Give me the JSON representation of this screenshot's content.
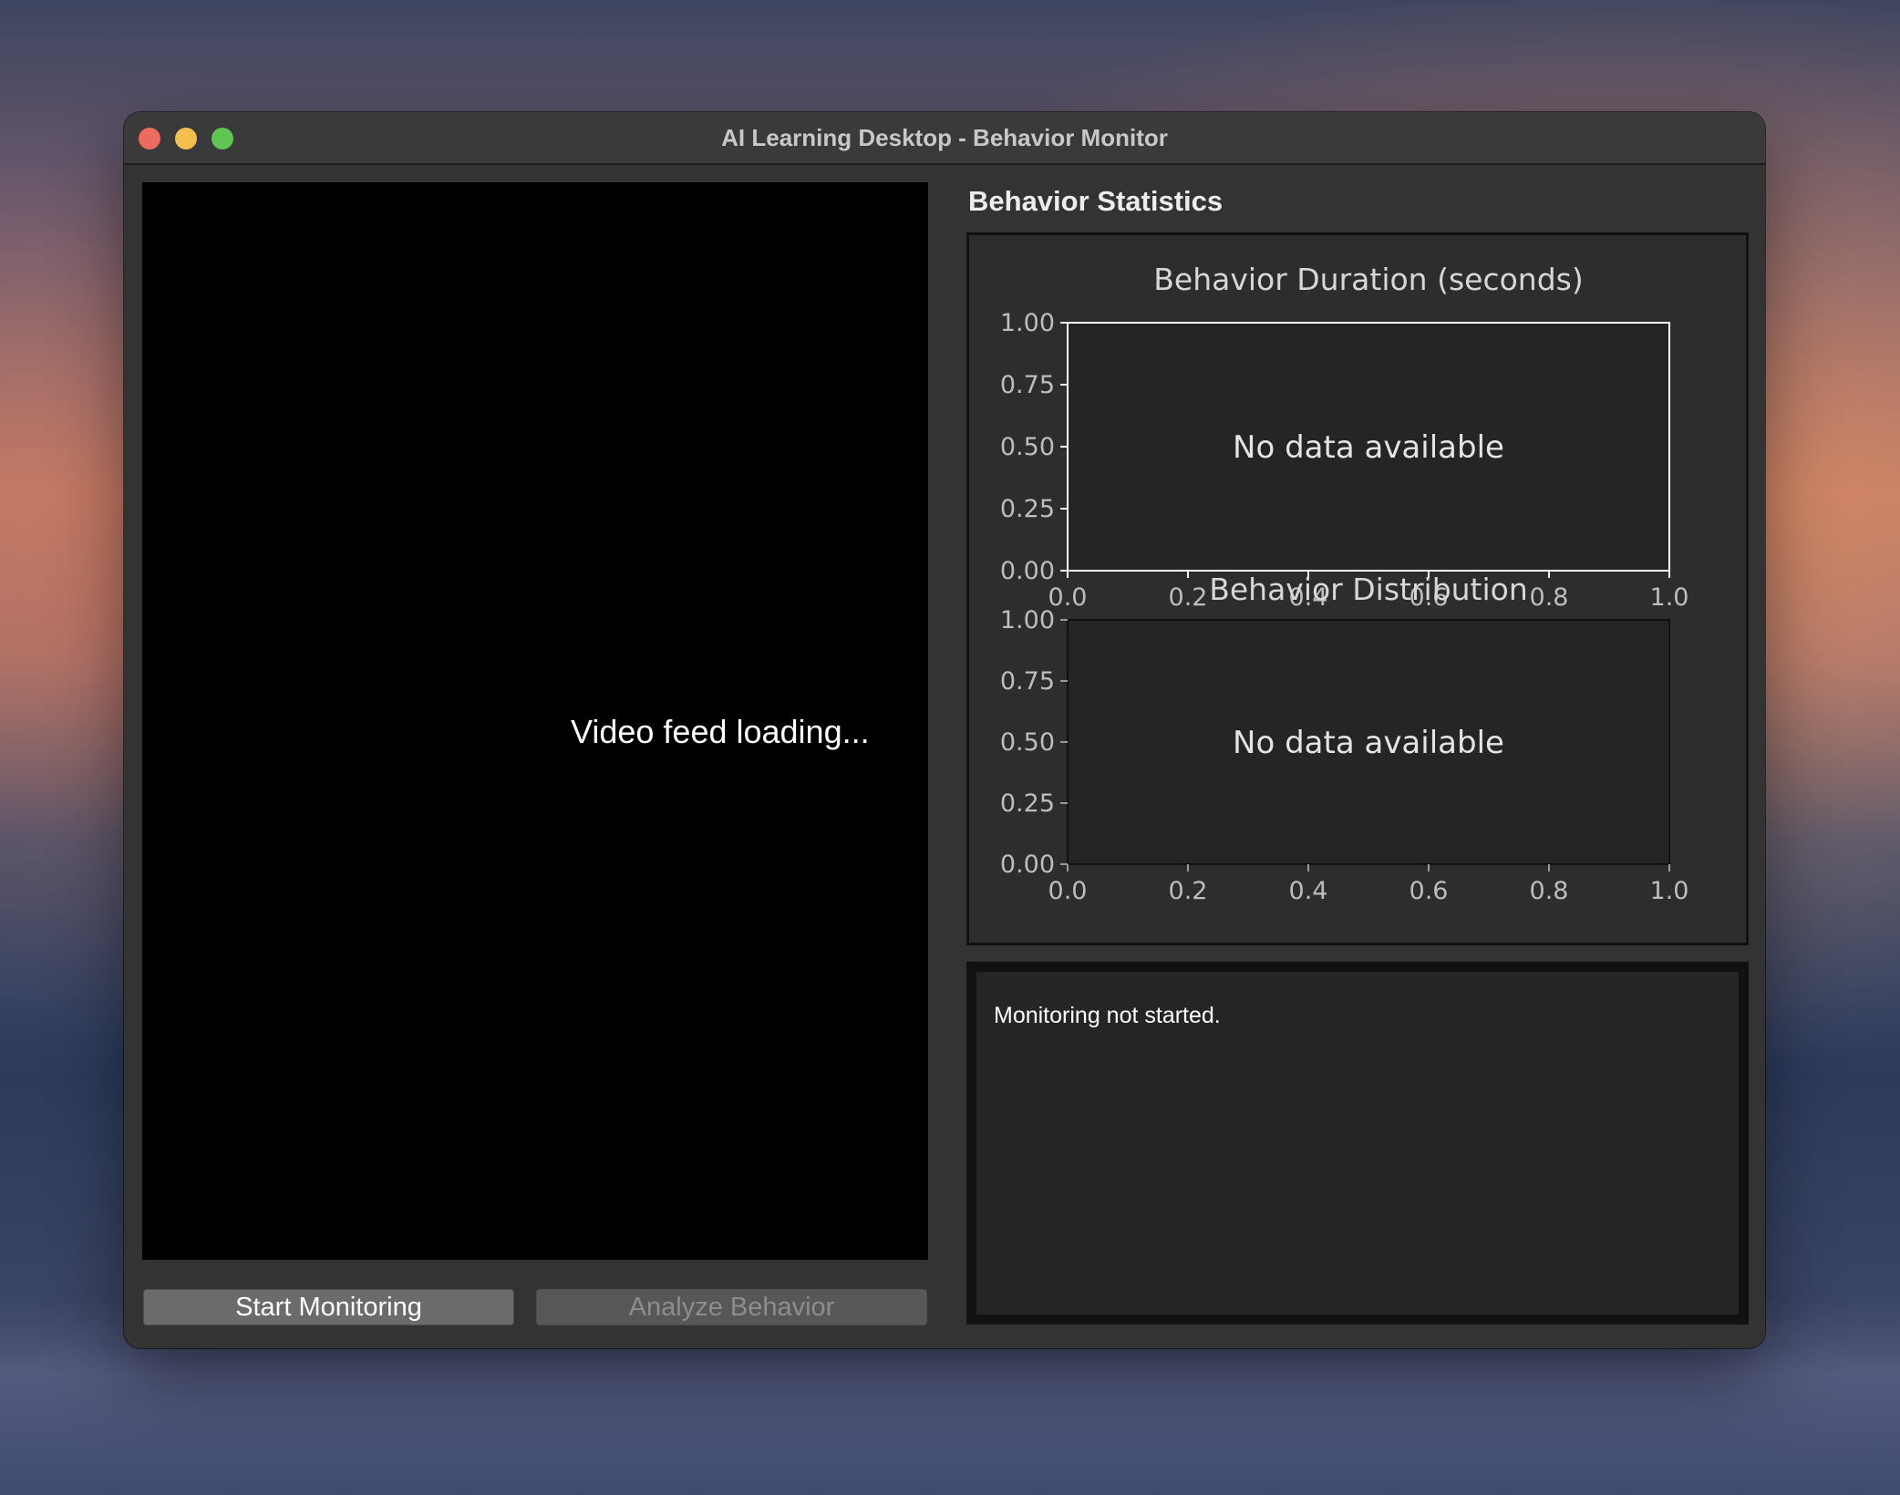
{
  "window": {
    "title": "AI Learning Desktop - Behavior Monitor"
  },
  "video": {
    "status_text": "Video feed loading..."
  },
  "controls": {
    "start_label": "Start Monitoring",
    "analyze_label": "Analyze Behavior",
    "analyze_enabled": false
  },
  "stats": {
    "heading": "Behavior Statistics"
  },
  "chart_data": [
    {
      "type": "bar",
      "title": "Behavior Duration (seconds)",
      "annotation": "No data available",
      "xlim": [
        0.0,
        1.0
      ],
      "ylim": [
        0.0,
        1.0
      ],
      "xticks": [
        "0.0",
        "0.2",
        "0.4",
        "0.6",
        "0.8",
        "1.0"
      ],
      "yticks": [
        "0.00",
        "0.25",
        "0.50",
        "0.75",
        "1.00"
      ],
      "series": []
    },
    {
      "type": "bar",
      "title": "Behavior Distribution",
      "annotation": "No data available",
      "xlim": [
        0.0,
        1.0
      ],
      "ylim": [
        0.0,
        1.0
      ],
      "xticks": [
        "0.0",
        "0.2",
        "0.4",
        "0.6",
        "0.8",
        "1.0"
      ],
      "yticks": [
        "0.00",
        "0.25",
        "0.50",
        "0.75",
        "1.00"
      ],
      "series": []
    }
  ],
  "log": {
    "text": "Monitoring not started."
  },
  "colors": {
    "close": "#ed6a5e",
    "minimize": "#f5bf4f",
    "maximize": "#61c554"
  }
}
